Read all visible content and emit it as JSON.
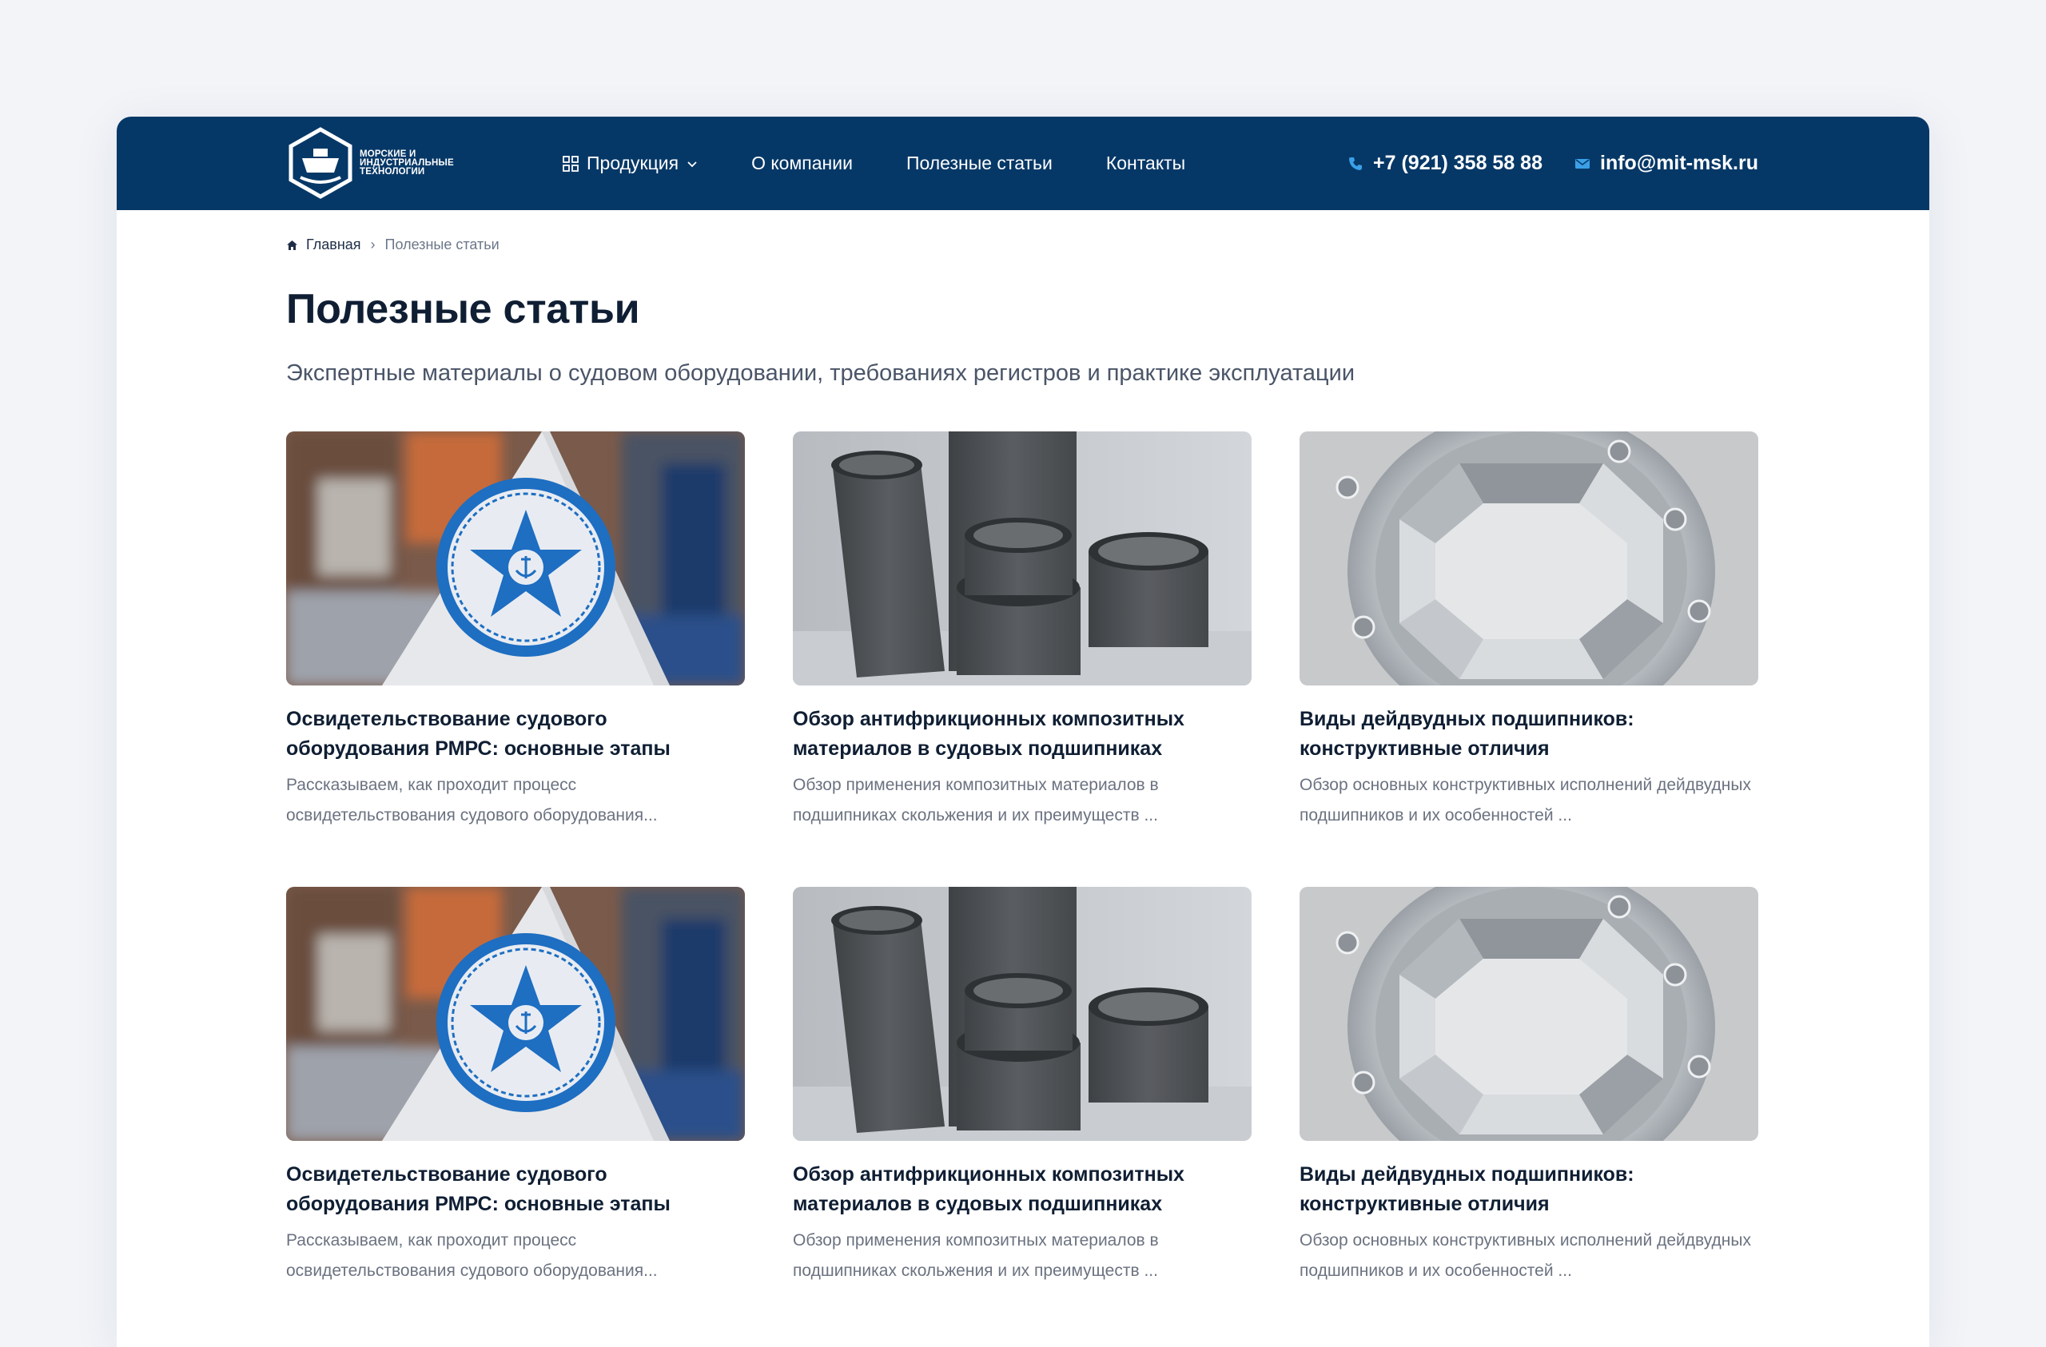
{
  "header": {
    "logo_lines": [
      "МОРСКИЕ И",
      "ИНДУСТРИАЛЬНЫЕ",
      "ТЕХНОЛОГИИ"
    ],
    "nav": [
      {
        "label": "Продукция",
        "icon": "grid-icon",
        "has_dropdown": true
      },
      {
        "label": "О компании"
      },
      {
        "label": "Полезные статьи"
      },
      {
        "label": "Контакты"
      }
    ],
    "phone": "+7 (921) 358 58 88",
    "email": "info@mit-msk.ru"
  },
  "breadcrumb": {
    "home": "Главная",
    "current": "Полезные статьи"
  },
  "page": {
    "title": "Полезные статьи",
    "subtitle": "Экспертные материалы о судовом оборудовании, требованиях регистров и практике эксплуатации"
  },
  "articles": [
    {
      "image": "rmrs-flag-image",
      "title": "Освидетельствование судового оборудования РМРС: основные этапы",
      "excerpt": "Рассказываем, как проходит процесс освидетельствования судового оборудования..."
    },
    {
      "image": "composite-bushings-image",
      "title": "Обзор антифрикционных композитных материалов в судовых подшипниках",
      "excerpt": "Обзор применения композитных материалов в подшипниках скольжения и их преимуществ ..."
    },
    {
      "image": "stern-tube-bearing-image",
      "title": "Виды дейдвудных подшипников: конструктивные отличия",
      "excerpt": "Обзор основных конструктивных исполнений дейдвудных подшипников и их особенностей ..."
    },
    {
      "image": "rmrs-flag-image",
      "title": "Освидетельствование судового оборудования РМРС: основные этапы",
      "excerpt": "Рассказываем, как проходит процесс освидетельствования судового оборудования..."
    },
    {
      "image": "composite-bushings-image",
      "title": "Обзор антифрикционных композитных материалов в судовых подшипниках",
      "excerpt": "Обзор применения композитных материалов в подшипниках скольжения и их преимуществ ..."
    },
    {
      "image": "stern-tube-bearing-image",
      "title": "Виды дейдвудных подшипников: конструктивные отличия",
      "excerpt": "Обзор основных конструктивных исполнений дейдвудных подшипников и их особенностей ..."
    }
  ],
  "colors": {
    "header_bg": "#063867",
    "accent_icon": "#3aa0e8",
    "title": "#0f1e33",
    "muted": "#6b7280"
  }
}
